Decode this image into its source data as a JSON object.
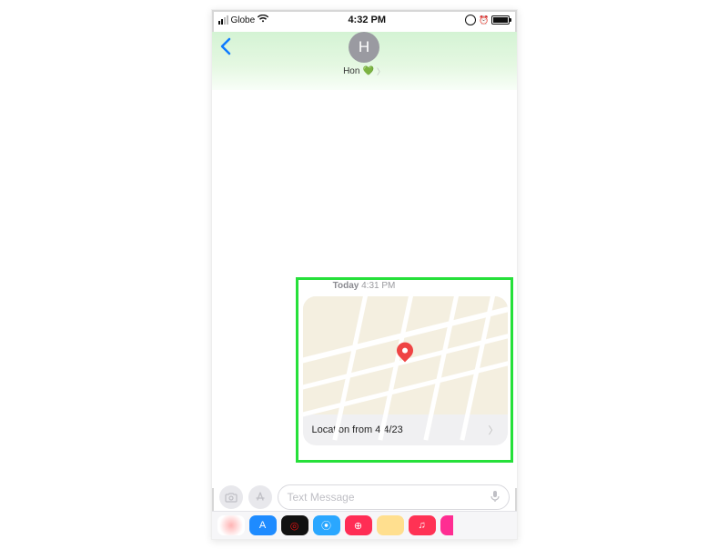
{
  "status": {
    "carrier": "Globe",
    "time": "4:32 PM"
  },
  "header": {
    "avatar_initial": "H",
    "contact_name": "Hon",
    "heart": "💚"
  },
  "conversation": {
    "timestamp_prefix": "Today",
    "timestamp_time": "4:31 PM",
    "location_label": "Location from 4/4/23"
  },
  "input": {
    "placeholder": "Text Message"
  },
  "apps": {
    "store": "A",
    "fitness": "◎",
    "sound": "⦿",
    "find": "⊕",
    "music": "♫"
  }
}
